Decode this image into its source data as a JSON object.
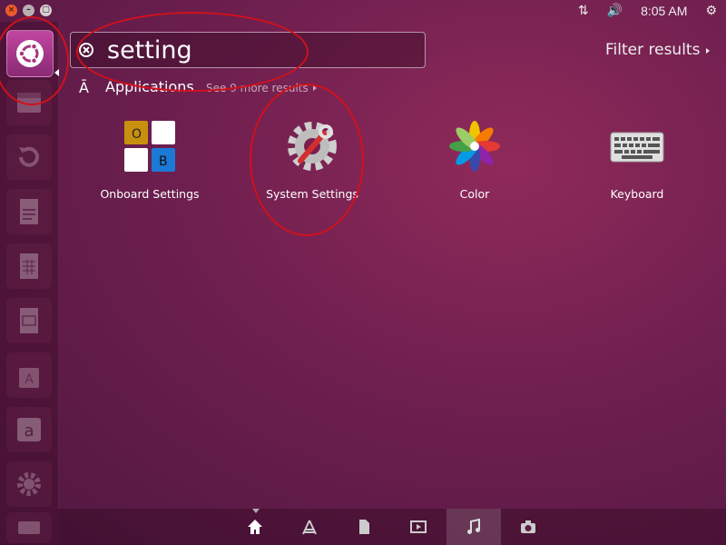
{
  "panel": {
    "clock": "8:05 AM",
    "window_buttons": [
      "close",
      "minimize",
      "maximize"
    ],
    "tray_icons": [
      "network-updown-icon",
      "volume-icon",
      "power-gear-icon"
    ]
  },
  "launcher": {
    "items": [
      {
        "name": "dash-home",
        "icon": "ubuntu-logo-icon"
      },
      {
        "name": "file-manager",
        "icon": "file-cabinet-icon"
      },
      {
        "name": "backup",
        "icon": "backup-arrow-icon"
      },
      {
        "name": "libreoffice-writer",
        "icon": "writer-document-icon"
      },
      {
        "name": "libreoffice-calc",
        "icon": "calc-spreadsheet-icon"
      },
      {
        "name": "libreoffice-impress",
        "icon": "impress-presentation-icon"
      },
      {
        "name": "software-center",
        "icon": "software-bag-icon"
      },
      {
        "name": "amazon",
        "icon": "amazon-icon"
      },
      {
        "name": "system-settings",
        "icon": "settings-gear-icon"
      },
      {
        "name": "usb-drive",
        "icon": "drive-icon"
      }
    ]
  },
  "search": {
    "query": "setting"
  },
  "filter": {
    "label": "Filter results"
  },
  "category": {
    "title": "Applications",
    "more": "See 9 more results"
  },
  "results": [
    {
      "label": "Onboard Settings",
      "icon": "onboard-keyboard-icon"
    },
    {
      "label": "System Settings",
      "icon": "system-settings-gear-icon"
    },
    {
      "label": "Color",
      "icon": "color-flower-icon"
    },
    {
      "label": "Keyboard",
      "icon": "keyboard-icon"
    }
  ],
  "onboard_keys": [
    "O",
    "",
    "",
    "B"
  ],
  "lenses": [
    {
      "name": "home",
      "icon": "home-icon"
    },
    {
      "name": "applications",
      "icon": "applications-icon"
    },
    {
      "name": "files",
      "icon": "file-icon"
    },
    {
      "name": "video",
      "icon": "video-icon"
    },
    {
      "name": "music",
      "icon": "music-note-icon"
    },
    {
      "name": "photos",
      "icon": "camera-icon"
    }
  ],
  "colors": {
    "annotation_ring": "#d0111b",
    "launcher_dash": "#c046a0"
  }
}
